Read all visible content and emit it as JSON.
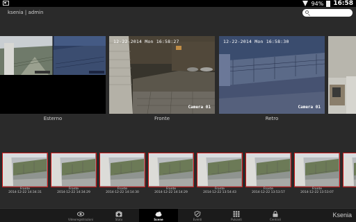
{
  "status_bar": {
    "battery": "94%",
    "time": "16:58"
  },
  "header": {
    "title": "ksenia | admin",
    "search_placeholder": ""
  },
  "cameras": [
    {
      "label": "Esterno",
      "timestamp": "",
      "tag": ""
    },
    {
      "label": "Fronte",
      "timestamp": "12-22-2014 Mon 16:58:27",
      "tag": "Camera 01"
    },
    {
      "label": "Retro",
      "timestamp": "12-22-2014 Mon 16:58:30",
      "tag": "Camera 01"
    },
    {
      "label": "",
      "timestamp": "",
      "tag": ""
    }
  ],
  "thumbnails": [
    {
      "name": "Fronte",
      "date": "2014-12-22 14:34:31"
    },
    {
      "name": "Fronte",
      "date": "2014-12-22 14:34:29"
    },
    {
      "name": "Fronte",
      "date": "2014-12-22 14:14:30"
    },
    {
      "name": "Fronte",
      "date": "2014-12-22 14:14:29"
    },
    {
      "name": "Fronte",
      "date": "2014-12-22 13:54:43"
    },
    {
      "name": "Fronte",
      "date": "2014-12-22 13:53:57"
    },
    {
      "name": "Fronte",
      "date": "2014-12-22 13:53:07"
    },
    {
      "name": "Fronte",
      "date": "2014-12-22"
    }
  ],
  "bottom_nav": [
    {
      "label": "Videoregistrazioni",
      "icon": "eye-icon",
      "active": false
    },
    {
      "label": "Stato",
      "icon": "first-aid-icon",
      "active": false
    },
    {
      "label": "Scene",
      "icon": "cloud-icon",
      "active": true
    },
    {
      "label": "Eventi",
      "icon": "shield-icon",
      "active": false
    },
    {
      "label": "Pulsanti",
      "icon": "grid-icon",
      "active": false
    },
    {
      "label": "Centrali",
      "icon": "lock-icon",
      "active": false
    }
  ],
  "brand": "Ksenia",
  "colors": {
    "accent_red": "#d01818",
    "background": "#2a2a2a"
  }
}
